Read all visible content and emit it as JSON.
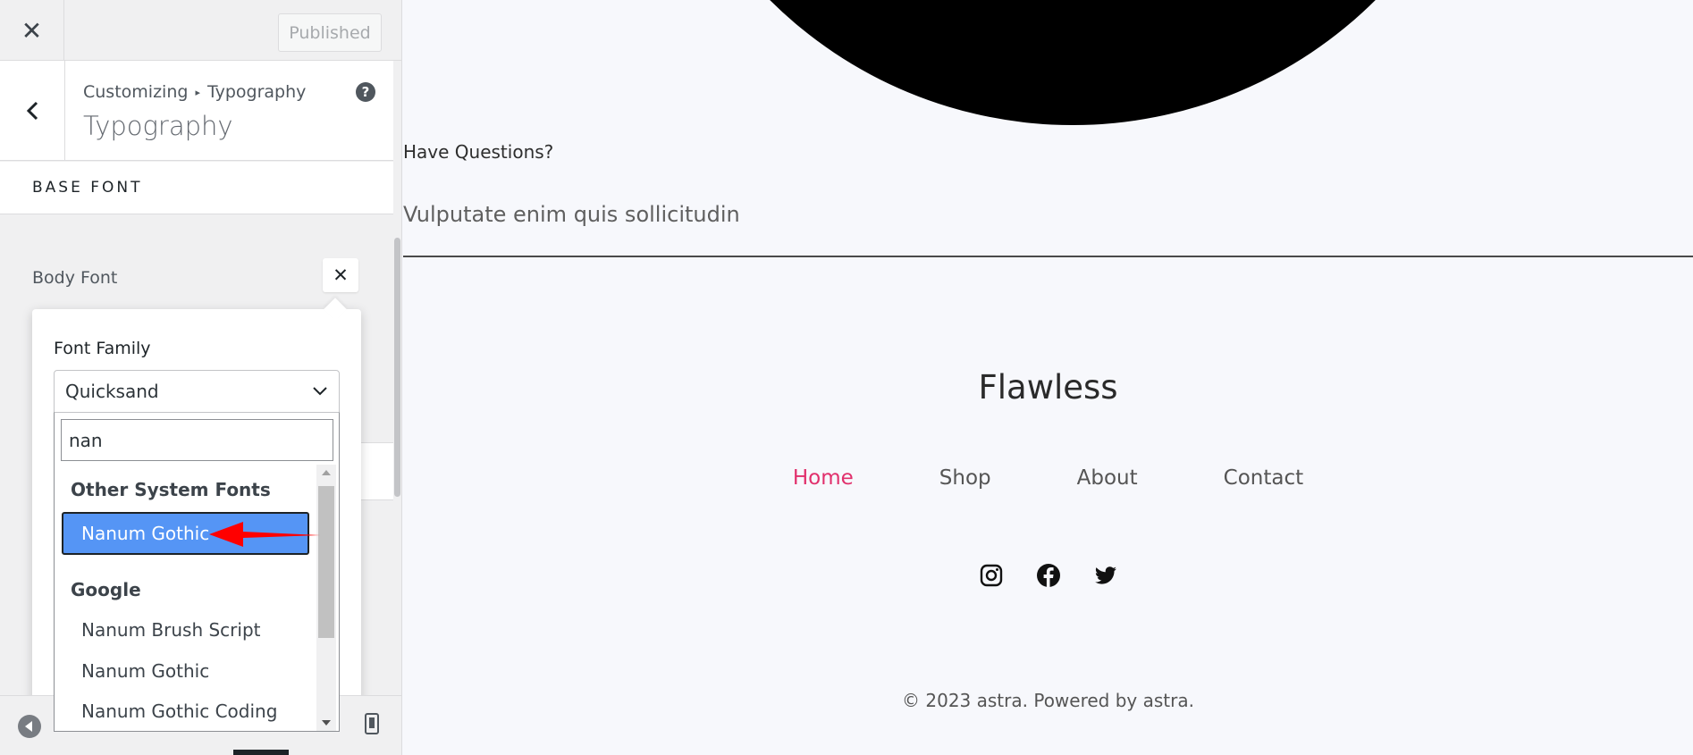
{
  "customizer": {
    "published_label": "Published",
    "breadcrumb": {
      "root": "Customizing",
      "separator": "▸",
      "current": "Typography"
    },
    "section_title": "Typography",
    "base_font_heading": "BASE FONT",
    "body_font_label": "Body Font",
    "font_family_label": "Font Family",
    "font_family_value": "Quicksand",
    "search_value": "nan",
    "groups": [
      {
        "label": "Other System Fonts",
        "options": [
          "Nanum Gothic"
        ]
      },
      {
        "label": "Google",
        "options": [
          "Nanum Brush Script",
          "Nanum Gothic",
          "Nanum Gothic Coding"
        ]
      }
    ],
    "selected_option": "Nanum Gothic",
    "icons": {
      "close": "close-icon",
      "back": "chevron-left-icon",
      "help": "help-icon",
      "reset": "close-icon",
      "dropdown": "chevron-down-icon",
      "collapse": "collapse-sidebar-icon",
      "device": "mobile-device-icon"
    },
    "colors": {
      "highlight": "#5595f5",
      "annotation_arrow": "#ff0000"
    }
  },
  "preview": {
    "have_questions": "Have Questions?",
    "tagline": "Vulputate enim quis sollicitudin",
    "site_title": "Flawless",
    "nav": [
      {
        "label": "Home",
        "active": true
      },
      {
        "label": "Shop",
        "active": false
      },
      {
        "label": "About",
        "active": false
      },
      {
        "label": "Contact",
        "active": false
      }
    ],
    "social_icons": [
      "instagram-icon",
      "facebook-icon",
      "twitter-icon"
    ],
    "copyright": "© 2023 astra. Powered by astra.",
    "colors": {
      "active_nav": "#e1306c"
    }
  }
}
